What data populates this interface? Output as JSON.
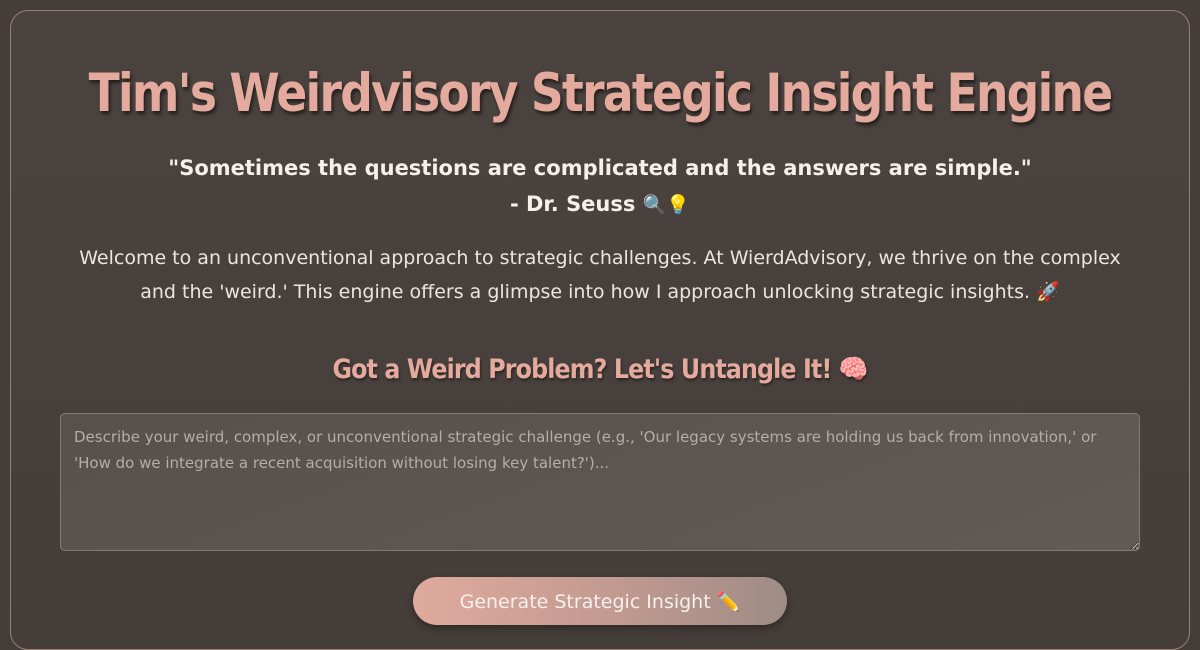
{
  "header": {
    "title": "Tim's Weirdvisory Strategic Insight Engine"
  },
  "quote": {
    "text": "\"Sometimes the questions are complicated and the answers are simple.\"",
    "author": "- Dr. Seuss",
    "emoji": "🔍💡"
  },
  "intro": {
    "text": "Welcome to an unconventional approach to strategic challenges. At WierdAdvisory, we thrive on the complex and the 'weird.' This engine offers a glimpse into how I approach unlocking strategic insights.",
    "emoji": "🚀"
  },
  "form": {
    "heading": "Got a Weird Problem? Let's Untangle It!",
    "heading_emoji": "🧠",
    "challenge_value": "",
    "challenge_placeholder": "Describe your weird, complex, or unconventional strategic challenge (e.g., 'Our legacy systems are holding us back from innovation,' or 'How do we integrate a recent acquisition without losing key talent?')...",
    "button_label": "Generate Strategic Insight",
    "button_emoji": "✏️"
  },
  "colors": {
    "background": "#453d39",
    "accent": "#e3aa9d",
    "text": "#f6efeb"
  }
}
